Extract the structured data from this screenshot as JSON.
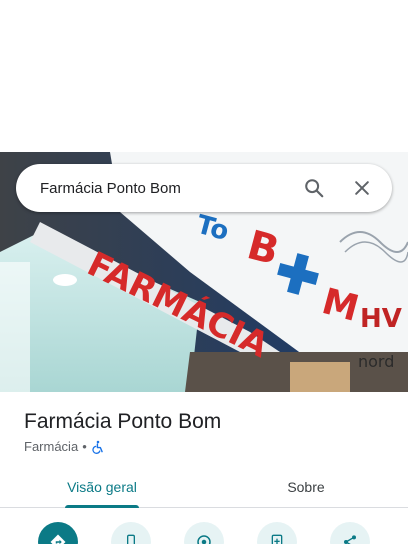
{
  "search": {
    "query": "Farmácia Ponto Bom"
  },
  "place": {
    "name": "Farmácia Ponto Bom",
    "category": "Farmácia",
    "separator": "•"
  },
  "tabs": [
    {
      "label": "Visão geral",
      "active": true
    },
    {
      "label": "Sobre",
      "active": false
    }
  ],
  "actions": [
    {
      "icon": "directions-icon"
    },
    {
      "icon": "phone-icon"
    },
    {
      "icon": "location-icon"
    },
    {
      "icon": "save-icon"
    },
    {
      "icon": "share-icon"
    }
  ],
  "photo": {
    "sign_text": "FARMÁCIA",
    "logo_text_1": "To",
    "logo_text_2": "B",
    "logo_text_3": "M",
    "side_letters": "HV",
    "side_small": "nord"
  },
  "colors": {
    "accent": "#0b7a86",
    "sign_red": "#d62a2a",
    "sign_blue": "#1c6fc0"
  }
}
